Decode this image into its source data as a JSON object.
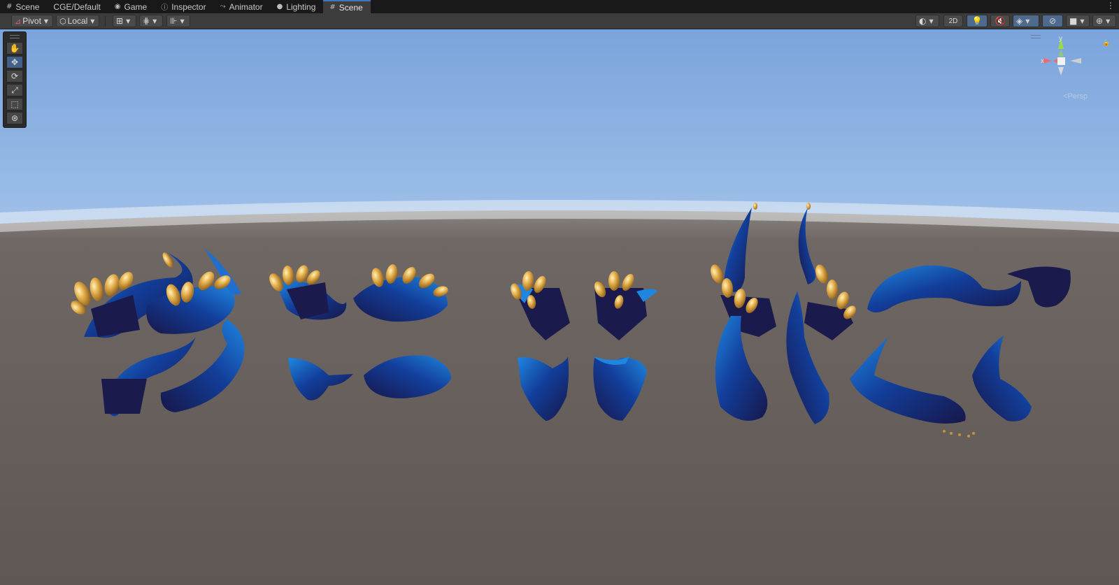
{
  "tabs": [
    {
      "label": "Scene",
      "icon": "grid-icon",
      "active": false
    },
    {
      "label": "CGE/Default",
      "icon": "",
      "active": false
    },
    {
      "label": "Game",
      "icon": "gamepad-icon",
      "active": false
    },
    {
      "label": "Inspector",
      "icon": "info-icon",
      "active": false
    },
    {
      "label": "Animator",
      "icon": "animator-icon",
      "active": false
    },
    {
      "label": "Lighting",
      "icon": "bulb-icon",
      "active": false
    },
    {
      "label": "Scene",
      "icon": "grid-icon",
      "active": true
    }
  ],
  "toolbar": {
    "pivot_label": "Pivot",
    "local_label": "Local",
    "mode_2d_label": "2D"
  },
  "gizmo": {
    "axis_x_label": "x",
    "axis_y_label": "y",
    "projection_label": "Persp"
  },
  "tools": [
    "hand-tool",
    "move-tool",
    "rotate-tool",
    "scale-tool",
    "rect-tool",
    "transform-tool"
  ],
  "active_tool": "move-tool",
  "colors": {
    "accent": "#3a79bb",
    "toolbar_bg": "#3c3c3c",
    "ground": "#6a625e",
    "sky_top": "#7ea8de",
    "horn_dark": "#1a1a4c",
    "horn_bright": "#1f7fd9",
    "gold": "#d4a23a"
  }
}
